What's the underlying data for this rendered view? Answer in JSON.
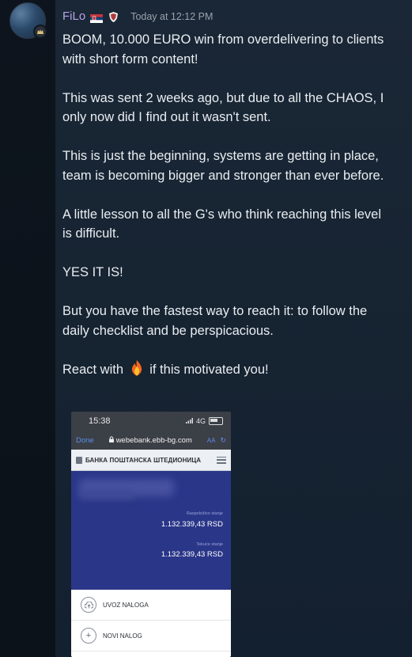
{
  "message": {
    "username": "FiLo",
    "username_color": "#b8a3e8",
    "timestamp": "Today at 12:12 PM",
    "paragraphs": [
      "BOOM, 10.000 EURO win from overdelivering to clients with short form content!",
      "This was sent 2 weeks ago, but due to all the CHAOS, I only now did I find out it wasn't sent.",
      "This is just the beginning, systems are getting in place, team is becoming bigger and stronger than ever before.",
      "A little lesson to all the G's who think reaching this level is difficult.",
      "YES IT IS!",
      "But you have the fastest way to reach it: to follow the daily checklist and be perspicacious."
    ],
    "react_prefix": "React with",
    "react_suffix": "if this motivated you!",
    "icons": [
      "avatar",
      "serbia-flag-icon",
      "shield-badge-icon",
      "fire-emoji-icon"
    ]
  },
  "attachment": {
    "status_time": "15:38",
    "network": "4G",
    "done_label": "Done",
    "url": "webebank.ebb-bg.com",
    "aa_label": "AA",
    "bank_name": "БАНКА ПОШТАНСКА ШТЕДИОНИЦА",
    "balances": [
      {
        "label": "Raspoloživo stanje",
        "value": "1.132.339,43 RSD"
      },
      {
        "label": "Tekuće stanje",
        "value": "1.132.339,43 RSD"
      }
    ],
    "actions": [
      {
        "label": "UVOZ NALOGA",
        "icon": "cloud-upload-icon"
      },
      {
        "label": "NOVI NALOG",
        "icon": "plus-circle-icon"
      }
    ]
  }
}
